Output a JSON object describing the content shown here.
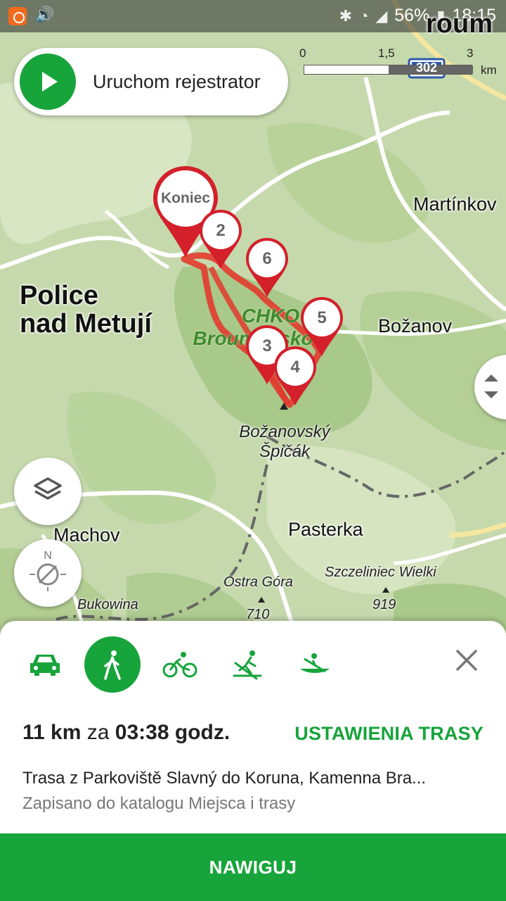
{
  "status_bar": {
    "battery": "56%",
    "time": "18:15"
  },
  "recorder": {
    "label": "Uruchom rejestrator"
  },
  "scale": {
    "t0": "0",
    "t1": "1,5",
    "t2": "3",
    "unit": "km",
    "road": "302"
  },
  "map_labels": {
    "police_line1": "Police",
    "police_line2": "nad Metují",
    "martinkov": "Martínkov",
    "bozanov": "Božanov",
    "chko_line1": "CHKO",
    "chko_line2": "Broumovsko",
    "spicak_line1": "Božanovský",
    "spicak_line2": "Špičák",
    "machov": "Machov",
    "pasterka": "Pasterka",
    "ostra_gora": "Ostra Góra",
    "szczeliniec": "Szczeliniec Wielki",
    "bukowina": "Bukowina",
    "ele_710": "710",
    "ele_919": "919",
    "broumov_partial": "roum"
  },
  "markers": {
    "end": "Koniec",
    "m2": "2",
    "m3": "3",
    "m4": "4",
    "m5": "5",
    "m6": "6"
  },
  "route_color": "#e23b2e",
  "accent": "#17a43b",
  "sheet": {
    "modes": [
      "car-icon",
      "walk-icon",
      "bike-icon",
      "ski-icon",
      "canoe-icon"
    ],
    "active_mode": "walk-icon",
    "distance": "11 km",
    "za": "za",
    "duration": "03:38 godz.",
    "settings_link": "USTAWIENIA TRASY",
    "route_name": "Trasa z Parkoviště Slavný do Koruna, Kamenna Bra...",
    "catalog": "Zapisano do katalogu Miejsca i trasy",
    "navigate": "NAWIGUJ"
  }
}
